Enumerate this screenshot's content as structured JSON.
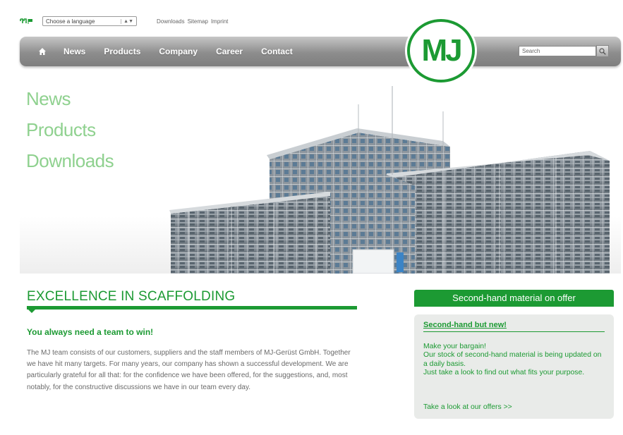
{
  "colors": {
    "brand_green": "#1c9a33",
    "light_green": "#8fd18f",
    "nav_gray": "#8d8d8d"
  },
  "topbar": {
    "flag_icon": "flag-icon",
    "language_select": {
      "value": "Choose a language"
    },
    "links": [
      "Downloads",
      "Sitemap",
      "Imprint"
    ]
  },
  "nav": {
    "home_icon": "home-icon",
    "items": [
      "News",
      "Products",
      "Company",
      "Career",
      "Contact"
    ],
    "search": {
      "placeholder": "Search",
      "icon": "search-icon"
    }
  },
  "logo": {
    "text": "MJ"
  },
  "hero": {
    "links": [
      "News",
      "Products",
      "Downloads"
    ],
    "image": "scaffolded-building"
  },
  "main": {
    "title": "EXCELLENCE IN SCAFFOLDING",
    "subheading": "You always need a team to win!",
    "body": "The MJ team consists of our customers, suppliers and the staff members of MJ-Gerüst GmbH. Together we have hit many targets. For many years, our company has shown a successful development. We are particularly grateful for all that: for the confidence we have been offered, for the suggestions, and, most notably, for the constructive discussions we have in our team every day."
  },
  "sidebar": {
    "header": "Second-hand material on offer",
    "subtitle": "Second-hand but new!",
    "lines": [
      "Make your bargain!",
      "Our stock of second-hand material is being updated on a daily basis.",
      "Just take a look to find out what fits your purpose."
    ],
    "link": "Take a look at our offers >>"
  }
}
